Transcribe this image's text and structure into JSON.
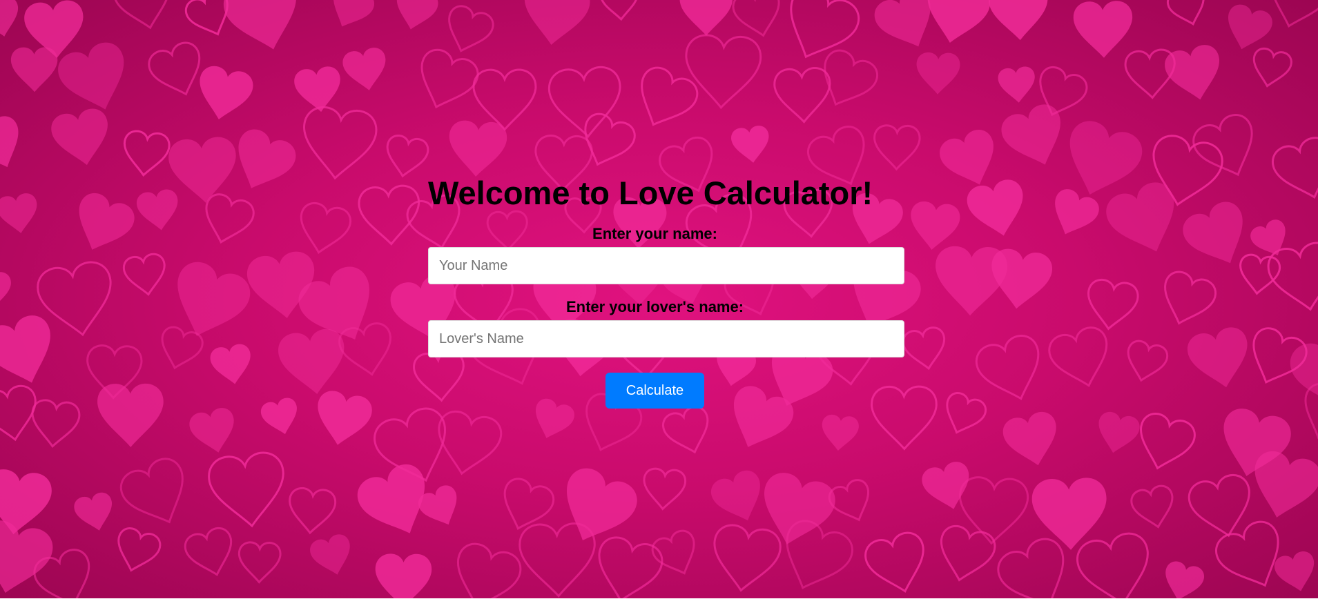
{
  "header": {
    "title": "Welcome to Love Calculator!"
  },
  "form": {
    "name_label": "Enter your name:",
    "name_placeholder": "Your Name",
    "name_value": "",
    "lover_label": "Enter your lover's name:",
    "lover_placeholder": "Lover's Name",
    "lover_value": "",
    "submit_label": "Calculate"
  },
  "colors": {
    "background_main": "#d30e75",
    "background_dark": "#9c0552",
    "heart_fill": "#f02b98",
    "button": "#007bff",
    "button_text": "#ffffff",
    "title_text": "#000000"
  },
  "icons": {
    "background_pattern": "heart-pattern"
  }
}
